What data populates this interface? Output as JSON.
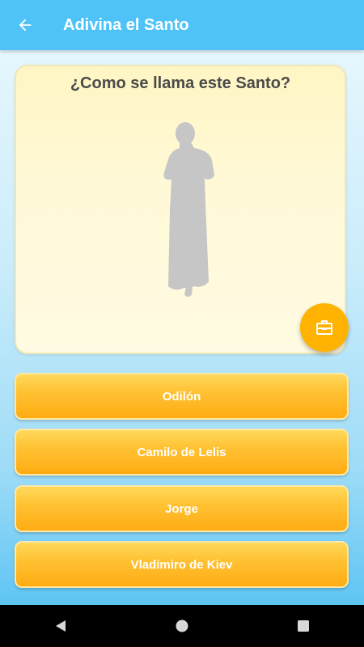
{
  "appbar": {
    "title": "Adivina el Santo",
    "back_icon": "arrow-back-icon",
    "color": "#4fc3f7"
  },
  "card": {
    "question": "¿Como se llama este Santo?",
    "image": "saint-silhouette",
    "background": "#fff9d8"
  },
  "hint_button": {
    "icon": "briefcase-icon",
    "color": "#ffb300"
  },
  "answers": [
    {
      "label": "Odilón"
    },
    {
      "label": "Camilo de Lelis"
    },
    {
      "label": "Jorge"
    },
    {
      "label": "Vladimiro de Kiev"
    }
  ],
  "answer_color": "#ffb300",
  "navbar": {
    "buttons": [
      "back-triangle-icon",
      "home-circle-icon",
      "recents-square-icon"
    ]
  }
}
